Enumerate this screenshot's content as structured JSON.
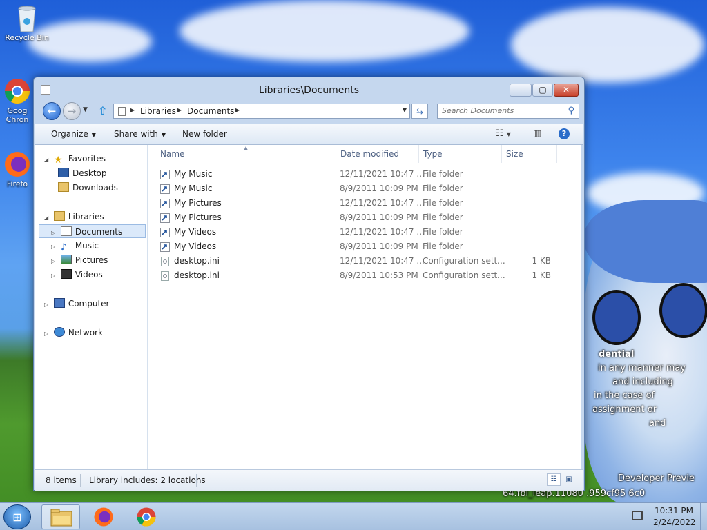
{
  "desktop": {
    "icons": [
      {
        "label": "Recycle Bin"
      },
      {
        "label": "Goog\nChron"
      },
      {
        "label": "Firefo"
      }
    ],
    "watermark": {
      "line1": "dential",
      "line2": "in any manner may",
      "line3": "and including",
      "line4": "in the case of",
      "line5": "assignment or",
      "line6": "and",
      "line7": "Developer Previe",
      "line8": "64.fbl_leap.11080 .959cf95 6c0"
    }
  },
  "window": {
    "title": "Libraries\\Documents",
    "controls": {
      "minimize": "–",
      "maximize": "▢",
      "close": "✕"
    }
  },
  "nav": {
    "back": "←",
    "forward": "→",
    "up": "⇧",
    "breadcrumb": [
      "Libraries",
      "Documents"
    ],
    "search_placeholder": "Search Documents"
  },
  "commands": {
    "organize": "Organize",
    "share_with": "Share with",
    "new_folder": "New folder"
  },
  "tree": {
    "favorites": "Favorites",
    "desktop": "Desktop",
    "downloads": "Downloads",
    "libraries": "Libraries",
    "documents": "Documents",
    "music": "Music",
    "pictures": "Pictures",
    "videos": "Videos",
    "computer": "Computer",
    "network": "Network"
  },
  "columns": {
    "name": "Name",
    "date_modified": "Date modified",
    "type": "Type",
    "size": "Size"
  },
  "files": [
    {
      "name": "My Music",
      "date": "12/11/2021 10:47 ...",
      "type": "File folder",
      "size": "",
      "icon": "folder-shortcut-icon"
    },
    {
      "name": "My Music",
      "date": "8/9/2011 10:09 PM",
      "type": "File folder",
      "size": "",
      "icon": "folder-shortcut-icon"
    },
    {
      "name": "My Pictures",
      "date": "12/11/2021 10:47 ...",
      "type": "File folder",
      "size": "",
      "icon": "folder-shortcut-icon"
    },
    {
      "name": "My Pictures",
      "date": "8/9/2011 10:09 PM",
      "type": "File folder",
      "size": "",
      "icon": "folder-shortcut-icon"
    },
    {
      "name": "My Videos",
      "date": "12/11/2021 10:47 ...",
      "type": "File folder",
      "size": "",
      "icon": "folder-shortcut-icon"
    },
    {
      "name": "My Videos",
      "date": "8/9/2011 10:09 PM",
      "type": "File folder",
      "size": "",
      "icon": "folder-shortcut-icon"
    },
    {
      "name": "desktop.ini",
      "date": "12/11/2021 10:47 ...",
      "type": "Configuration sett...",
      "size": "1 KB",
      "icon": "config-file-icon"
    },
    {
      "name": "desktop.ini",
      "date": "8/9/2011 10:53 PM",
      "type": "Configuration sett...",
      "size": "1 KB",
      "icon": "config-file-icon"
    }
  ],
  "status": {
    "count": "8 items",
    "library": "Library includes: 2 locations"
  },
  "taskbar": {
    "time": "10:31 PM",
    "date": "2/24/2022"
  }
}
